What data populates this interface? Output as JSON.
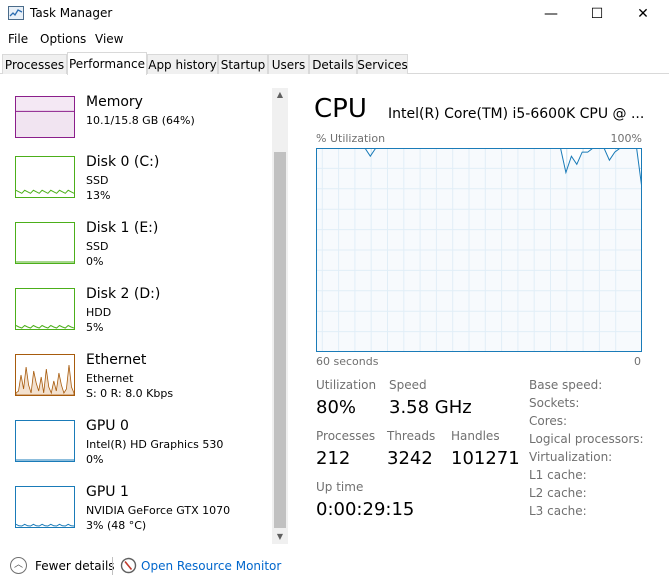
{
  "window": {
    "title": "Task Manager",
    "minimize": "—",
    "maximize": "☐",
    "close": "✕"
  },
  "menu": [
    "File",
    "Options",
    "View"
  ],
  "tabs": [
    {
      "label": "Processes",
      "active": false
    },
    {
      "label": "Performance",
      "active": true
    },
    {
      "label": "App history",
      "active": false
    },
    {
      "label": "Startup",
      "active": false
    },
    {
      "label": "Users",
      "active": false
    },
    {
      "label": "Details",
      "active": false
    },
    {
      "label": "Services",
      "active": false
    }
  ],
  "resources": [
    {
      "name": "Memory",
      "line1": "10.1/15.8 GB (64%)",
      "line2": "",
      "color": "#8b1e8b",
      "fill": "#f4e8f4",
      "level": 0.64
    },
    {
      "name": "Disk 0 (C:)",
      "line1": "SSD",
      "line2": "13%",
      "color": "#4caf1a",
      "fill": "#ffffff",
      "level": 0.13
    },
    {
      "name": "Disk 1 (E:)",
      "line1": "SSD",
      "line2": "0%",
      "color": "#4caf1a",
      "fill": "#ffffff",
      "level": 0
    },
    {
      "name": "Disk 2 (D:)",
      "line1": "HDD",
      "line2": "5%",
      "color": "#4caf1a",
      "fill": "#ffffff",
      "level": 0.05
    },
    {
      "name": "Ethernet",
      "line1": "Ethernet",
      "line2": "S: 0 R: 8.0 Kbps",
      "color": "#a75b0d",
      "fill": "#ffffff",
      "level": 0.3
    },
    {
      "name": "GPU 0",
      "line1": "Intel(R) HD Graphics 530",
      "line2": "0%",
      "color": "#1a7bb8",
      "fill": "#ffffff",
      "level": 0
    },
    {
      "name": "GPU 1",
      "line1": "NVIDIA GeForce GTX 1070",
      "line2": "3% (48 °C)",
      "color": "#1a7bb8",
      "fill": "#ffffff",
      "level": 0.03
    }
  ],
  "cpu": {
    "title": "CPU",
    "model": "Intel(R) Core(TM) i5-6600K CPU @ ...",
    "util_label": "% Utilization",
    "util_max": "100%",
    "x_left": "60 seconds",
    "x_right": "0",
    "graph_color": "#1a7bb8",
    "graph_fill": "#f1f7fc",
    "grid_color": "#c9e1f1",
    "stats": {
      "utilization_label": "Utilization",
      "utilization": "80%",
      "speed_label": "Speed",
      "speed": "3.58 GHz",
      "processes_label": "Processes",
      "processes": "212",
      "threads_label": "Threads",
      "threads": "3242",
      "handles_label": "Handles",
      "handles": "101271",
      "uptime_label": "Up time",
      "uptime": "0:00:29:15"
    },
    "specs": [
      "Base speed:",
      "Sockets:",
      "Cores:",
      "Logical processors:",
      "Virtualization:",
      "L1 cache:",
      "L2 cache:",
      "L3 cache:"
    ]
  },
  "chart_data": {
    "type": "area",
    "title": "",
    "xlabel": "60 seconds",
    "ylabel": "% Utilization",
    "ylim": [
      0,
      100
    ],
    "xlim": [
      60,
      0
    ],
    "x": [
      60,
      59,
      58,
      57,
      56,
      55,
      54,
      53,
      52,
      51,
      50,
      49,
      48,
      47,
      46,
      45,
      44,
      43,
      42,
      41,
      40,
      39,
      38,
      37,
      36,
      35,
      34,
      33,
      32,
      31,
      30,
      29,
      28,
      27,
      26,
      25,
      24,
      23,
      22,
      21,
      20,
      19,
      18,
      17,
      16,
      15,
      14,
      13,
      12,
      11,
      10,
      9,
      8,
      7,
      6,
      5,
      4,
      3,
      2,
      1,
      0
    ],
    "series": [
      {
        "values": [
          100,
          100,
          100,
          100,
          100,
          100,
          100,
          100,
          100,
          100,
          96,
          100,
          100,
          100,
          100,
          100,
          100,
          100,
          100,
          100,
          100,
          100,
          100,
          100,
          100,
          100,
          100,
          100,
          100,
          100,
          100,
          100,
          100,
          100,
          100,
          100,
          100,
          100,
          100,
          100,
          100,
          100,
          100,
          100,
          100,
          100,
          88,
          96,
          92,
          98,
          98,
          100,
          100,
          100,
          94,
          98,
          100,
          100,
          100,
          100,
          80
        ]
      }
    ]
  },
  "footer": {
    "fewer_details": "Fewer details",
    "open_monitor": "Open Resource Monitor"
  }
}
